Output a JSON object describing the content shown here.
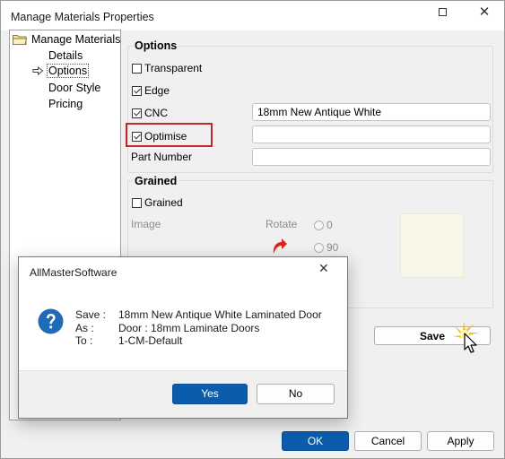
{
  "window": {
    "title": "Manage Materials Properties",
    "close_glyph": "✕"
  },
  "tree": {
    "root": "Manage Materials",
    "items": [
      {
        "label": "Details",
        "selected": false
      },
      {
        "label": "Options",
        "selected": true
      },
      {
        "label": "Door Style",
        "selected": false
      },
      {
        "label": "Pricing",
        "selected": false
      }
    ]
  },
  "options_group": {
    "title": "Options",
    "transparent": {
      "label": "Transparent",
      "checked": false
    },
    "edge": {
      "label": "Edge",
      "checked": true
    },
    "cnc": {
      "label": "CNC",
      "checked": true,
      "value": "18mm New Antique White"
    },
    "optimise": {
      "label": "Optimise",
      "checked": true,
      "value": ""
    },
    "part_number": {
      "label": "Part Number",
      "value": ""
    }
  },
  "grained_group": {
    "title": "Grained",
    "grained": {
      "label": "Grained",
      "checked": false
    },
    "image_label": "Image",
    "rotate_label": "Rotate",
    "rotate_options": [
      "0",
      "90"
    ]
  },
  "save_button": "Save",
  "footer_buttons": {
    "ok": "OK",
    "cancel": "Cancel",
    "apply": "Apply"
  },
  "dialog": {
    "title": "AllMasterSoftware",
    "close_glyph": "✕",
    "labels": [
      "Save :",
      "As :",
      "To :"
    ],
    "values": [
      "18mm New Antique White Laminated Door",
      "Door : 18mm Laminate Doors",
      "1-CM-Default"
    ],
    "yes": "Yes",
    "no": "No"
  },
  "colors": {
    "accent": "#0b5cad",
    "highlight": "#c0262c",
    "icon_blue": "#1e6bb8",
    "rotate_red": "#d9261c"
  },
  "icons": [
    "folder-icon",
    "arrow-right-icon",
    "question-icon",
    "rotate-icon",
    "mouse-cursor-icon"
  ]
}
